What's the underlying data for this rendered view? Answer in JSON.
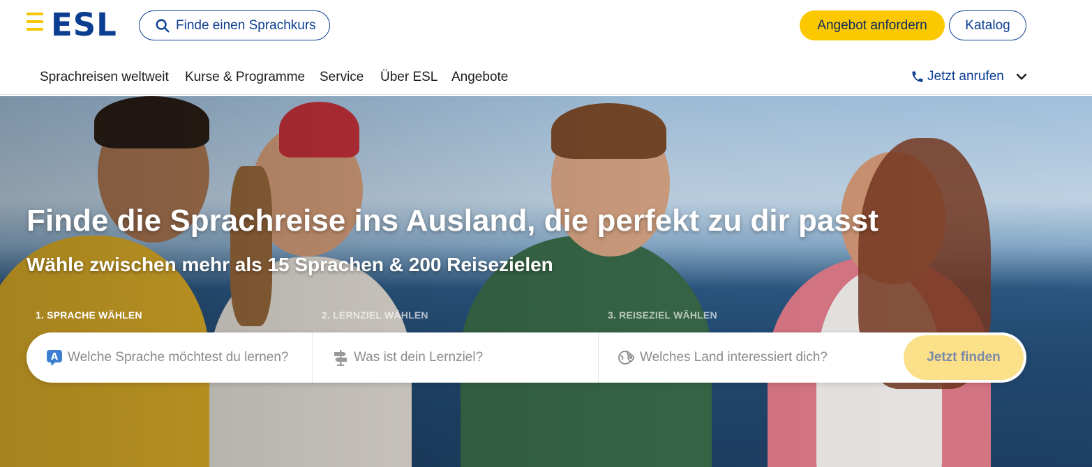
{
  "header": {
    "logo_text": "ESL",
    "search_pill_label": "Finde einen Sprachkurs",
    "offer_button_label": "Angebot anfordern",
    "catalog_button_label": "Katalog"
  },
  "nav": {
    "items": [
      {
        "label": "Sprachreisen weltweit"
      },
      {
        "label": "Kurse & Programme"
      },
      {
        "label": "Service"
      },
      {
        "label": "Über ESL"
      },
      {
        "label": "Angebote"
      }
    ],
    "call_label": "Jetzt anrufen"
  },
  "hero": {
    "title": "Finde die Sprachreise ins Ausland, die perfekt zu dir passt",
    "subtitle": "Wähle zwischen mehr als 15 Sprachen & 200 Reisezielen",
    "steps": [
      {
        "label": "1. SPRACHE WÄHLEN"
      },
      {
        "label": "2. LERNZIEL WÄHLEN"
      },
      {
        "label": "3. REISEZIEL WÄHLEN"
      }
    ],
    "finder": {
      "language_placeholder": "Welche Sprache möchtest du lernen?",
      "goal_placeholder": "Was ist dein Lernziel?",
      "destination_placeholder": "Welches Land interessiert dich?",
      "submit_label": "Jetzt finden"
    }
  },
  "colors": {
    "brand_blue": "#0b3d91",
    "brand_yellow": "#fcc800"
  }
}
